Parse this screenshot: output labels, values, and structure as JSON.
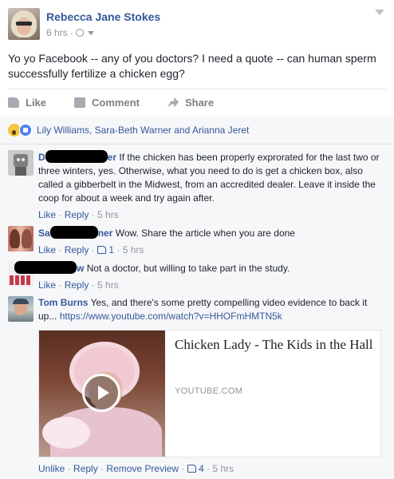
{
  "post": {
    "author": "Rebecca Jane Stokes",
    "time": "6 hrs",
    "separator": "·",
    "text": "Yo yo Facebook -- any of you doctors? I need a quote -- can human sperm successfully fertilize a chicken egg?"
  },
  "actions": {
    "like": "Like",
    "comment": "Comment",
    "share": "Share"
  },
  "reactions": {
    "names": "Lily Williams, Sara-Beth Warner and Arianna Jeret"
  },
  "comments": [
    {
      "author_visible_start": "D",
      "author_visible_end": "er",
      "text": "If the chicken has been properly exprorated for the last two or three winters, yes. Otherwise, what you need to do is get a chicken box, also called a gibberbelt in the Midwest, from an accredited dealer. Leave it inside the coop for about a week and try again after.",
      "like": "Like",
      "reply": "Reply",
      "time": "5 hrs"
    },
    {
      "author_visible_start": "Sa",
      "author_visible_end": "ner",
      "text": "Wow. Share the article when you are done",
      "like": "Like",
      "reply": "Reply",
      "like_count": "1",
      "time": "5 hrs"
    },
    {
      "author_visible_end": "w",
      "text": "Not a doctor, but willing to take part in the study.",
      "like": "Like",
      "reply": "Reply",
      "time": "5 hrs"
    },
    {
      "author": "Tom Burns",
      "text": "Yes, and there's some pretty compelling video evidence to back it up...",
      "link": "https://www.youtube.com/watch?v=HHOFmHMTN5k",
      "unlike": "Unlike",
      "reply": "Reply",
      "remove_preview": "Remove Preview",
      "like_count": "4",
      "time": "5 hrs"
    }
  ],
  "preview": {
    "title": "Chicken Lady - The Kids in the Hall",
    "domain": "YOUTUBE.COM"
  },
  "colors": {
    "link_blue": "#365899",
    "meta_gray": "#90949c",
    "comment_bg": "#f6f7f9"
  }
}
